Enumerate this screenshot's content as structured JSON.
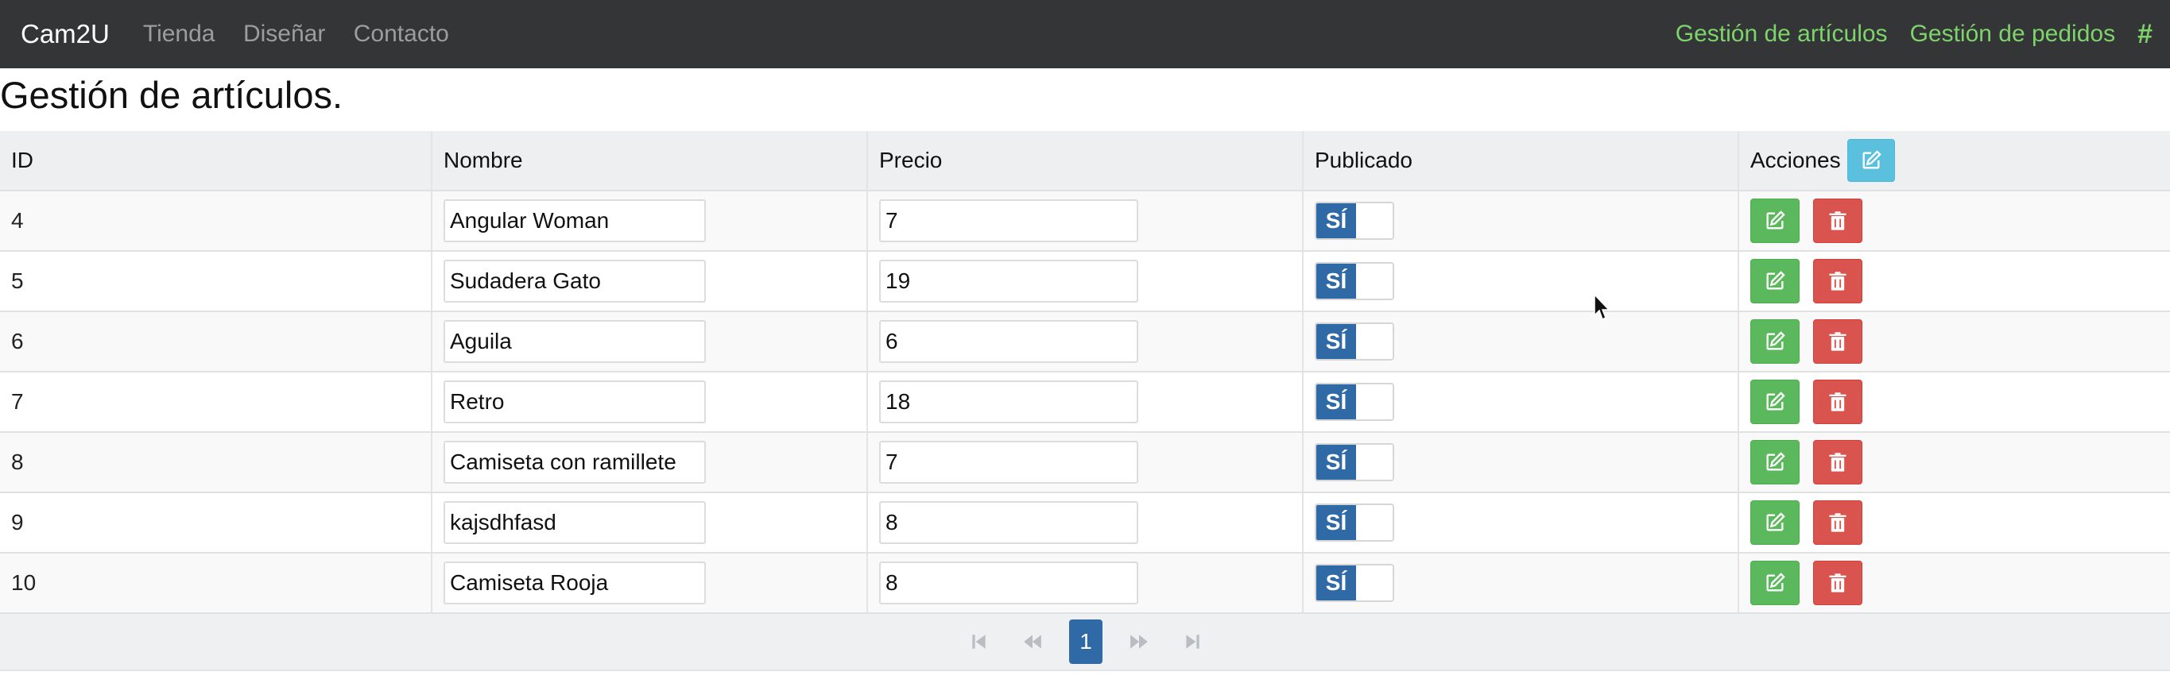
{
  "navbar": {
    "brand": "Cam2U",
    "left_links": [
      "Tienda",
      "Diseñar",
      "Contacto"
    ],
    "right_links": [
      "Gestión de artículos",
      "Gestión de pedidos"
    ],
    "hash": "#"
  },
  "page": {
    "title": "Gestión de artículos."
  },
  "table": {
    "headers": {
      "id": "ID",
      "nombre": "Nombre",
      "precio": "Precio",
      "publicado": "Publicado",
      "acciones": "Acciones"
    },
    "published_label": "SÍ",
    "rows": [
      {
        "id": "4",
        "nombre": "Angular Woman",
        "precio": "7"
      },
      {
        "id": "5",
        "nombre": "Sudadera Gato",
        "precio": "19"
      },
      {
        "id": "6",
        "nombre": "Aguila",
        "precio": "6"
      },
      {
        "id": "7",
        "nombre": "Retro",
        "precio": "18"
      },
      {
        "id": "8",
        "nombre": "Camiseta con ramillete",
        "precio": "7"
      },
      {
        "id": "9",
        "nombre": "kajsdhfasd",
        "precio": "8"
      },
      {
        "id": "10",
        "nombre": "Camiseta Rooja",
        "precio": "8"
      }
    ]
  },
  "pagination": {
    "current_page": "1"
  },
  "colors": {
    "navbar_bg": "#333537",
    "nav_accent": "#7ed36b",
    "primary": "#2f6aa7",
    "success": "#5cb85c",
    "danger": "#d9534f",
    "info": "#5bc0de"
  },
  "icons": {
    "add": "edit-icon",
    "edit": "edit-icon",
    "delete": "trash-icon",
    "first": "first-page-icon",
    "prev": "prev-page-icon",
    "next": "next-page-icon",
    "last": "last-page-icon"
  }
}
